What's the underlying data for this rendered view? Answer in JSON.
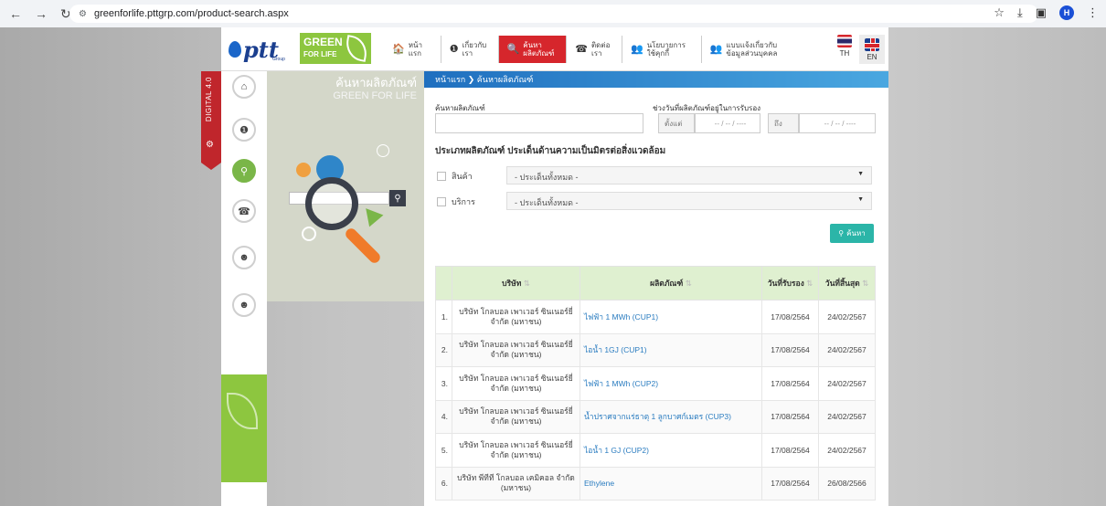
{
  "browser": {
    "url": "greenforlife.pttgrp.com/product-search.aspx",
    "profile_initial": "H"
  },
  "header": {
    "ptt_logo": "ptt",
    "ptt_group": "Group",
    "green_logo_line1": "GREEN",
    "green_logo_line2": "FOR LIFE",
    "menu": [
      {
        "icon": "home-icon",
        "glyph": "🏠",
        "label": "หน้าแรก"
      },
      {
        "icon": "info-icon",
        "glyph": "❶",
        "label": "เกี่ยวกับเรา"
      },
      {
        "icon": "search-icon",
        "glyph": "🔍",
        "label": "ค้นหาผลิตภัณฑ์"
      },
      {
        "icon": "contact-icon",
        "glyph": "☎",
        "label": "ติดต่อเรา"
      },
      {
        "icon": "policy-icon",
        "glyph": "👥",
        "label": "นโยบายการใช้คุกกี้"
      },
      {
        "icon": "privacy-icon",
        "glyph": "👥",
        "label": "แบบแจ้งเกี่ยวกับข้อมูลส่วนบุคคล"
      }
    ],
    "lang_th": "TH",
    "lang_en": "EN"
  },
  "sidebar": {
    "digital_label": "DIGITAL 4.0"
  },
  "illustration": {
    "title": "ค้นหาผลิตภัณฑ์",
    "subtitle": "GREEN FOR LIFE"
  },
  "content": {
    "breadcrumb": "หน้าแรก  ❯  ค้นหาผลิตภัณฑ์",
    "search_label": "ค้นหาผลิตภัณฑ์",
    "date_range_label": "ช่วงวันที่ผลิตภัณฑ์อยู่ในการรับรอง",
    "date_from_label": "ตั้งแต่",
    "date_to_label": "ถึง",
    "date_placeholder": "-- / -- / ----",
    "type_title": "ประเภทผลิตภัณฑ์  ประเด็นด้านความเป็นมิตรต่อสิ่งแวดล้อม",
    "type_rows": [
      {
        "label": "สินค้า",
        "select": "- ประเด็นทั้งหมด -"
      },
      {
        "label": "บริการ",
        "select": "- ประเด็นทั้งหมด -"
      }
    ],
    "search_button": "ค้นหา"
  },
  "table": {
    "headers": [
      "บริษัท",
      "ผลิตภัณฑ์",
      "วันที่รับรอง",
      "วันที่สิ้นสุด"
    ],
    "rows": [
      {
        "num": "1.",
        "company": "บริษัท โกลบอล เพาเวอร์ ซินเนอร์ยี่ จำกัด (มหาชน)",
        "product": "ไฟฟ้า 1 MWh (CUP1)",
        "start": "17/08/2564",
        "end": "24/02/2567"
      },
      {
        "num": "2.",
        "company": "บริษัท โกลบอล เพาเวอร์ ซินเนอร์ยี่ จำกัด (มหาชน)",
        "product": "ไอน้ำ 1GJ (CUP1)",
        "start": "17/08/2564",
        "end": "24/02/2567"
      },
      {
        "num": "3.",
        "company": "บริษัท โกลบอล เพาเวอร์ ซินเนอร์ยี่ จำกัด (มหาชน)",
        "product": "ไฟฟ้า 1 MWh (CUP2)",
        "start": "17/08/2564",
        "end": "24/02/2567"
      },
      {
        "num": "4.",
        "company": "บริษัท โกลบอล เพาเวอร์ ซินเนอร์ยี่ จำกัด (มหาชน)",
        "product": "น้ำปราศจากแร่ธาตุ 1 ลูกบาศก์เมตร (CUP3)",
        "start": "17/08/2564",
        "end": "24/02/2567"
      },
      {
        "num": "5.",
        "company": "บริษัท โกลบอล เพาเวอร์ ซินเนอร์ยี่ จำกัด (มหาชน)",
        "product": "ไอน้ำ 1 GJ (CUP2)",
        "start": "17/08/2564",
        "end": "24/02/2567"
      },
      {
        "num": "6.",
        "company": "บริษัท พีทีที โกลบอล เคมิคอล จำกัด (มหาชน)",
        "product": "Ethylene",
        "start": "17/08/2564",
        "end": "26/08/2566"
      }
    ]
  }
}
